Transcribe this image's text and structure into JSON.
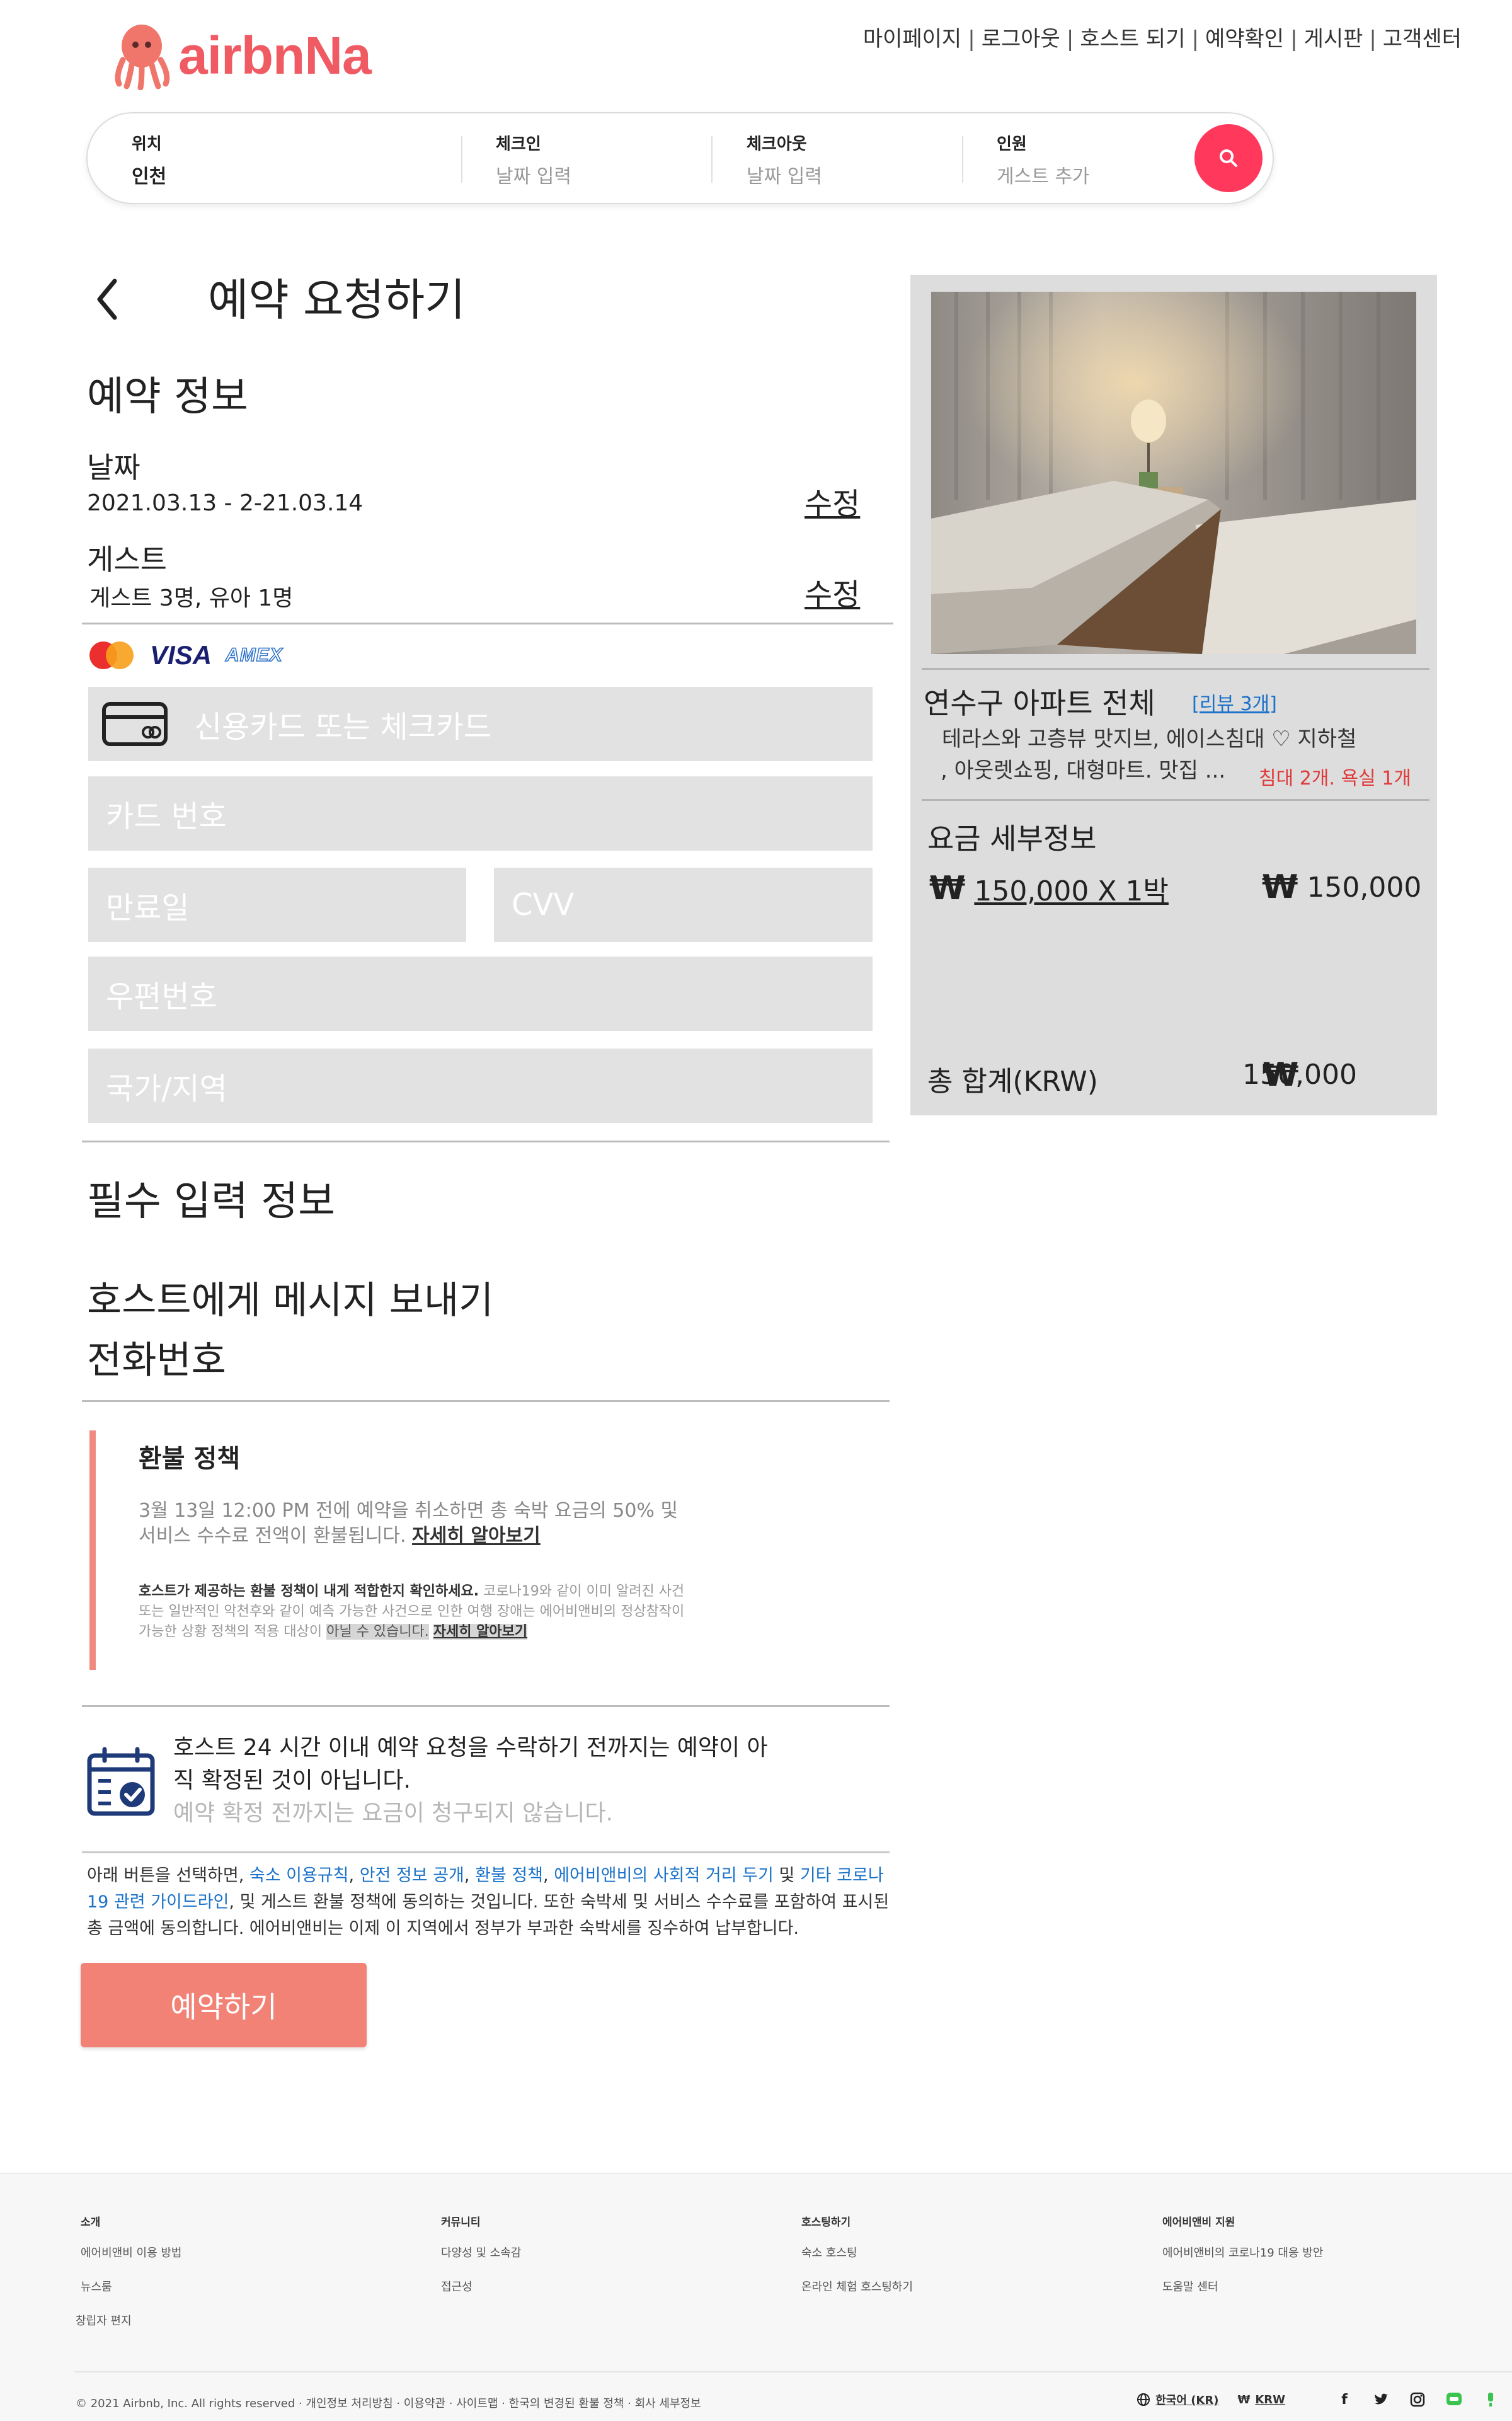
{
  "brand": {
    "logo_text": "airbnNa",
    "logo_color": "#f05a63"
  },
  "topnav": [
    "마이페이지",
    "로그아웃",
    "호스트 되기",
    "예약확인",
    "게시판",
    "고객센터"
  ],
  "search": {
    "location_label": "위치",
    "location_value": "인천",
    "checkin_label": "체크인",
    "checkin_placeholder": "날짜 입력",
    "checkout_label": "체크아웃",
    "checkout_placeholder": "날짜 입력",
    "guests_label": "인원",
    "guests_placeholder": "게스트 추가",
    "button_color": "#ff385c"
  },
  "page": {
    "title": "예약 요청하기",
    "back_icon": "chevron-left-icon"
  },
  "booking_info": {
    "heading": "예약 정보",
    "date_label": "날짜",
    "date_value": "2021.03.13 - 2-21.03.14",
    "date_edit": "수정",
    "guest_label": "게스트",
    "guest_value": "게스트 3명, 유아 1명",
    "guest_edit": "수정"
  },
  "payment": {
    "card_brands": [
      "mastercard-icon",
      "VISA",
      "AMEX"
    ],
    "card_type_placeholder": "신용카드 또는 체크카드",
    "card_number_placeholder": "카드 번호",
    "expiry_placeholder": "만료일",
    "cvv_placeholder": "CVV",
    "postal_placeholder": "우편번호",
    "country_placeholder": "국가/지역"
  },
  "required_info": {
    "heading": "필수 입력 정보",
    "message_host": "호스트에게 메시지 보내기",
    "phone": "전화번호"
  },
  "refund": {
    "title": "환불 정책",
    "text": "3월 13일 12:00 PM 전에 예약을 취소하면 총 숙박 요금의 50% 및 서비스 수수료 전액이 환불됩니다.",
    "learn_more": "자세히 알아보기",
    "small_strong": "호스트가 제공하는 환불 정책이 내게 적합한지 확인하세요.",
    "small_text": "코로나19와 같이 이미 알려진 사건 또는 일반적인 악천후와 같이 예측 가능한 사건으로 인한 여행 장애는 에어비앤비의 정상참작이 가능한 상황 정책의 적용 대상이",
    "small_highlight": "아닐 수 있습니다.",
    "small_link": "자세히 알아보기"
  },
  "notice": {
    "main": "호스트 24 시간 이내 예약 요청을 수락하기 전까지는 예약이 아직 확정된 것이 아닙니다.",
    "sub": "예약 확정 전까지는 요금이 청구되지 않습니다."
  },
  "terms": {
    "prefix": "아래 버튼을 선택하면, ",
    "link1": "숙소 이용규칙",
    "link2": "안전 정보 공개",
    "link3": "환불 정책",
    "link4": "에어비앤비의 사회적 거리 두기",
    "and": " 및 ",
    "link5": "기타 코로나19 관련 가이드라인",
    "suffix": ", 및 게스트 환불 정책에 동의하는 것입니다. 또한 숙박세 및 서비스 수수료를 포함하여 표시된 총 금액에 동의합니다. 에어비앤비는 이제 이 지역에서 정부가 부과한 숙박세를 징수하여 납부합니다."
  },
  "book_button": {
    "label": "예약하기",
    "color": "#f28276"
  },
  "listing": {
    "title": "연수구 아파트 전체",
    "reviews": "[리뷰 3개]",
    "desc_line1": "테라스와 고층뷰 맛지브, 에이스침대 ♡ 지하철",
    "desc_line2": ", 아웃렛쇼핑, 대형마트. 맛집 ...",
    "beds": "침대 2개. 욕실 1개",
    "price_heading": "요금 세부정보",
    "nightly": "150,000 X 1박",
    "nightly_total": "150,000",
    "total_label": "총 합계(KRW)",
    "total_value": "150,000",
    "currency_symbol": "₩"
  },
  "footer": {
    "columns": [
      {
        "head": "소개",
        "items": [
          "에어비앤비 이용 방법",
          "뉴스룸",
          "창립자 편지"
        ]
      },
      {
        "head": "커뮤니티",
        "items": [
          "다양성 및 소속감",
          "접근성"
        ]
      },
      {
        "head": "호스팅하기",
        "items": [
          "숙소 호스팅",
          "온라인 체험 호스팅하기"
        ]
      },
      {
        "head": "에어비앤비 지원",
        "items": [
          "에어비앤비의 코로나19 대응 방안",
          "도움말 센터"
        ]
      }
    ],
    "copyright": "© 2021 Airbnb, Inc. All rights reserved",
    "links": [
      "개인정보 처리방침",
      "이용약관",
      "사이트맵",
      "한국의 변경된 환불 정책",
      "회사 세부정보"
    ],
    "language": "한국어 (KR)",
    "currency": "KRW",
    "currency_symbol": "₩"
  }
}
